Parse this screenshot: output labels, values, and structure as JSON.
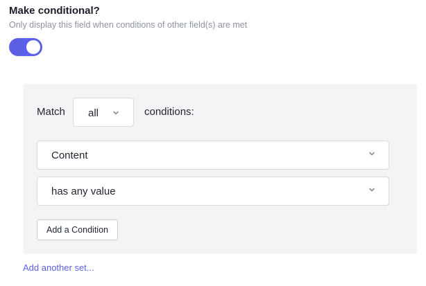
{
  "conditional": {
    "heading": "Make conditional?",
    "description": "Only display this field when conditions of other field(s) are met",
    "toggle_on": true
  },
  "match": {
    "label": "Match",
    "selected": "all",
    "suffix": "conditions:"
  },
  "condition": {
    "field": "Content",
    "operator": "has any value"
  },
  "buttons": {
    "add_condition": "Add a Condition",
    "add_set": "Add another set..."
  },
  "colors": {
    "accent": "#5b5fe6",
    "panel_bg": "#f4f4f6",
    "border": "#d8dae1",
    "muted_text": "#8e93a3"
  },
  "icons": {
    "dropdown": "chevron-down-icon"
  }
}
